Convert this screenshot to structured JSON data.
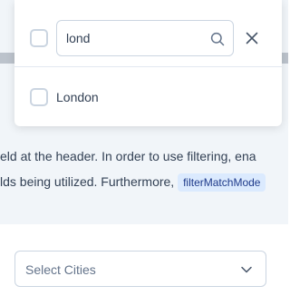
{
  "overlay": {
    "filter": {
      "value": "lond"
    },
    "options": [
      {
        "label": "London"
      }
    ]
  },
  "doc": {
    "line1": "eld at the header. In order to use filtering, ena",
    "line2": "lds being utilized. Furthermore, ",
    "code": "filterMatchMode"
  },
  "multiselect": {
    "placeholder": "Select Cities"
  },
  "colors": {
    "accent": "#3b82f6",
    "border": "#cbd5e1",
    "code_bg": "#dbeafe"
  }
}
